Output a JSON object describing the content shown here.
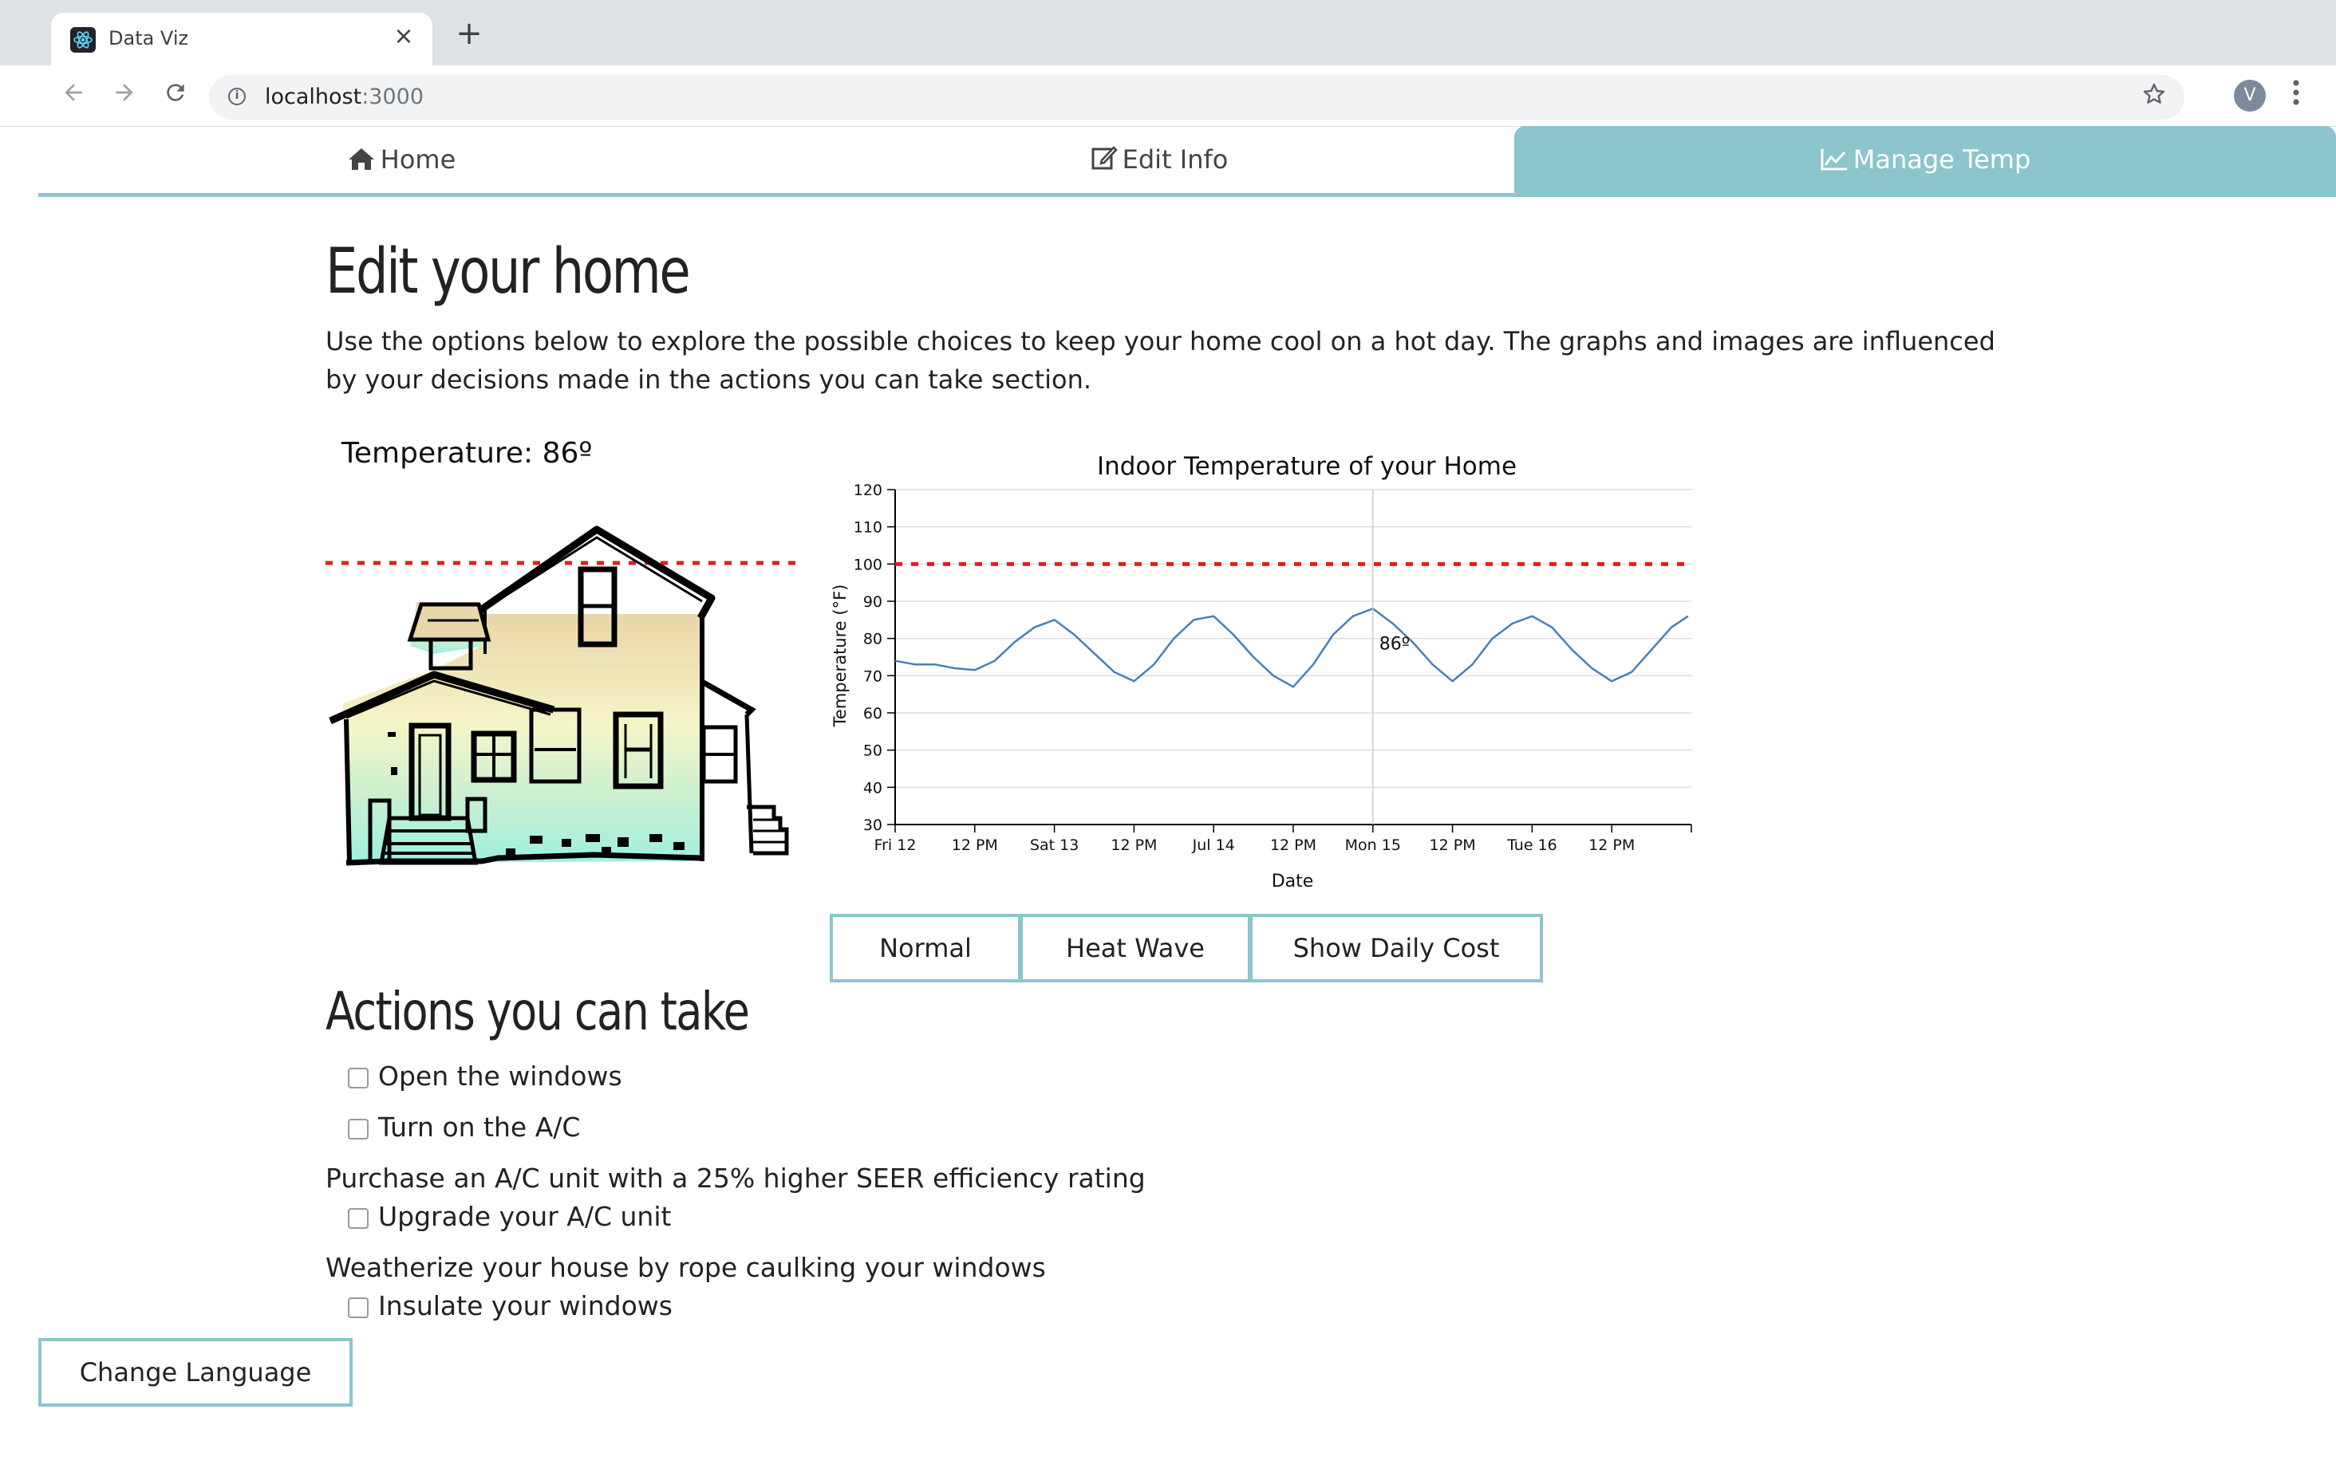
{
  "browser": {
    "tab_title": "Data Viz",
    "close_glyph": "×",
    "new_tab_glyph": "+",
    "url_host": "localhost",
    "url_port": ":3000",
    "avatar_letter": "V",
    "icons": [
      "react-favicon",
      "back-arrow-icon",
      "forward-arrow-icon",
      "reload-icon",
      "info-icon",
      "star-icon",
      "more-vert-icon"
    ]
  },
  "nav": {
    "items": [
      {
        "label": "Home",
        "icon": "home-icon",
        "active": false
      },
      {
        "label": "Edit Info",
        "icon": "edit-icon",
        "active": false
      },
      {
        "label": "Manage Temp",
        "icon": "line-chart-icon",
        "active": true
      }
    ],
    "accent": "#8cc5cc"
  },
  "page": {
    "title": "Edit your home",
    "intro": "Use the options below to explore the possible choices to keep your home cool on a hot day. The graphs and images are influenced by your decisions made in the actions you can take section.",
    "temperature_label": "Temperature: 86º"
  },
  "chart_data": {
    "type": "line",
    "title": "Indoor Temperature of your Home",
    "xlabel": "Date",
    "ylabel": "Temperature (°F)",
    "ylim": [
      30,
      120
    ],
    "yticks": [
      30,
      40,
      50,
      60,
      70,
      80,
      90,
      100,
      110,
      120
    ],
    "xticks": [
      "Fri 12",
      "12 PM",
      "Sat 13",
      "12 PM",
      "Jul 14",
      "12 PM",
      "Mon 15",
      "12 PM",
      "Tue 16",
      "12 PM"
    ],
    "grid": true,
    "threshold": {
      "value": 100,
      "style": "dashed",
      "color": "#e02020"
    },
    "series": [
      {
        "color": "#4a7fb5",
        "x_hours": [
          0,
          3,
          6,
          9,
          12,
          15,
          18,
          21,
          24,
          27,
          30,
          33,
          36,
          39,
          42,
          45,
          48,
          51,
          54,
          57,
          60,
          63,
          66,
          69,
          72,
          75,
          78,
          81,
          84,
          87,
          90,
          93,
          96,
          99,
          102,
          105,
          108,
          111,
          114,
          117,
          119.5
        ],
        "values": [
          74,
          73,
          73,
          72,
          71.5,
          74,
          79,
          83,
          85,
          81,
          76,
          71,
          68.5,
          73,
          80,
          85,
          86,
          81,
          75,
          70,
          67,
          73,
          81,
          86,
          88,
          84,
          79,
          73,
          68.5,
          73,
          80,
          84,
          86,
          83,
          77,
          72,
          68.5,
          71,
          77,
          83,
          86
        ]
      }
    ],
    "annotation": {
      "x_hour": 72,
      "label": "86º"
    }
  },
  "buttons": {
    "normal": "Normal",
    "heat_wave": "Heat Wave",
    "daily_cost": "Show Daily Cost"
  },
  "actions": {
    "title": "Actions you can take",
    "open_windows": "Open the windows",
    "turn_on_ac": "Turn on the A/C",
    "purchase_text": "Purchase an A/C unit with a 25% higher SEER efficiency rating",
    "upgrade_ac": "Upgrade your A/C unit",
    "weatherize_text": "Weatherize your house by rope caulking your windows",
    "insulate": "Insulate your windows"
  },
  "footer": {
    "change_language": "Change Language"
  }
}
